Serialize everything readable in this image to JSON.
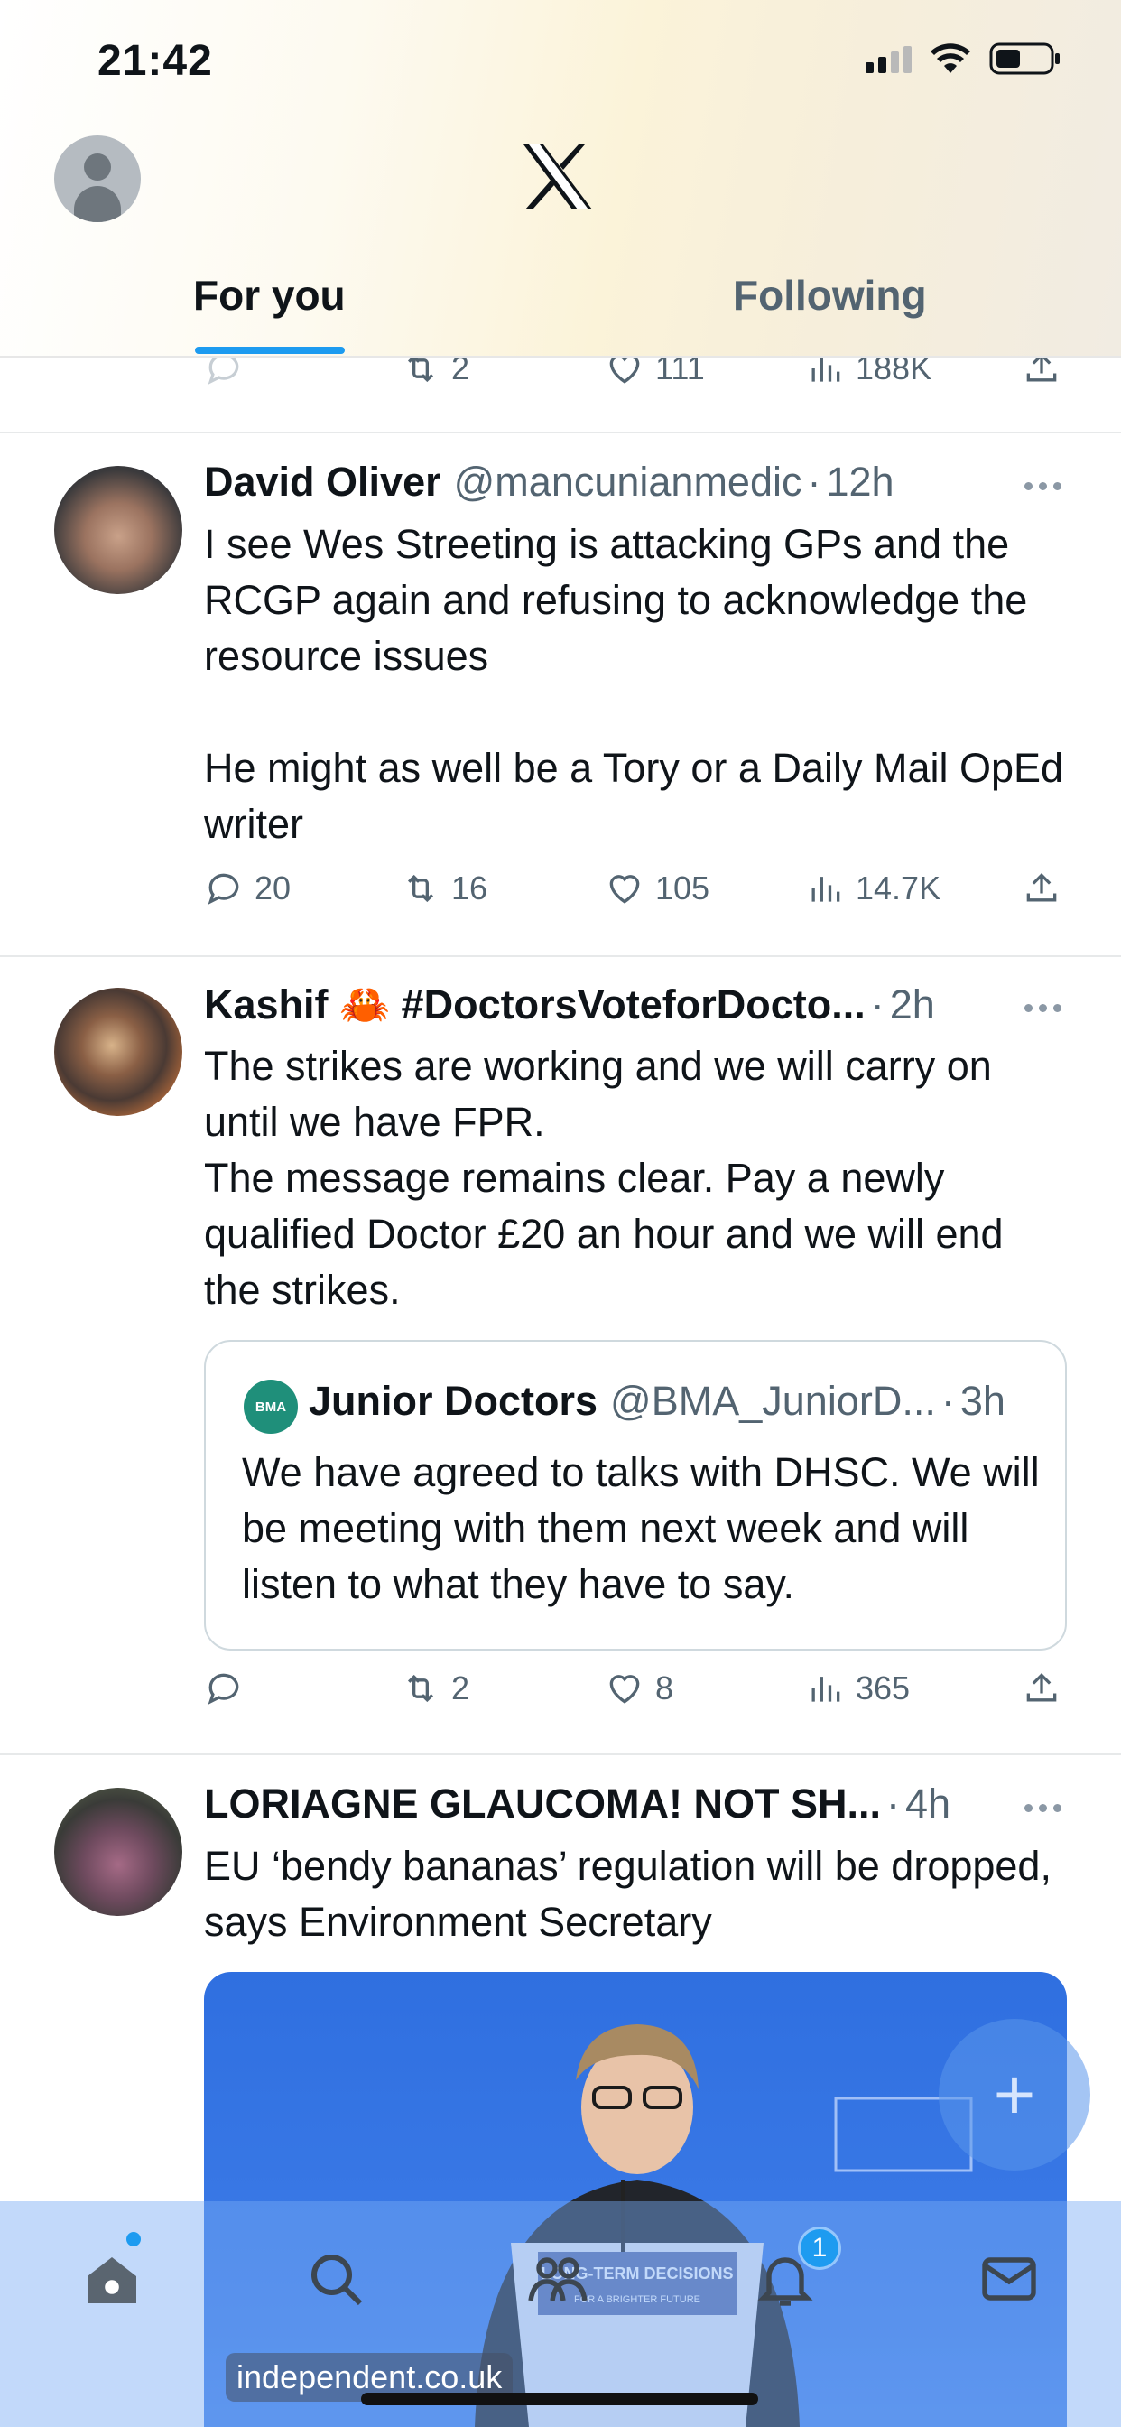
{
  "status_bar": {
    "time": "21:42"
  },
  "header": {
    "tabs": [
      {
        "label": "For you",
        "active": true
      },
      {
        "label": "Following",
        "active": false
      }
    ]
  },
  "accent_color": "#1d9bf0",
  "partial_tweet": {
    "actions": {
      "replies": "",
      "retweets": "2",
      "likes": "111",
      "views": "188K"
    }
  },
  "tweets": [
    {
      "name": "David Oliver",
      "handle": "@mancunianmedic",
      "time": "12h",
      "text": "I see Wes Streeting is attacking GPs and the RCGP again and refusing to acknowledge the resource issues\n\nHe might as well be a Tory or a Daily Mail OpEd writer",
      "actions": {
        "replies": "20",
        "retweets": "16",
        "likes": "105",
        "views": "14.7K"
      }
    },
    {
      "name": "Kashif 🦀 #DoctorsVoteforDocto...",
      "handle": "",
      "time": "2h",
      "text": "The strikes are working and we will carry on until we have FPR.\nThe message remains clear. Pay a newly qualified Doctor £20 an hour and we will end the strikes.",
      "quote": {
        "avatar_label": "BMA",
        "name": "Junior Doctors",
        "handle": "@BMA_JuniorD...",
        "time": "3h",
        "text": "We have agreed to talks with DHSC. We will be meeting with them next week and will listen to what they have to say."
      },
      "actions": {
        "replies": "",
        "retweets": "2",
        "likes": "8",
        "views": "365"
      }
    },
    {
      "name": "LORIAGNE GLAUCOMA! NOT SH...",
      "handle": "",
      "time": "4h",
      "text": "EU ‘bendy bananas’ regulation will be dropped, says Environment Secretary",
      "media": {
        "podium_text": "LONG-TERM DECISIONS",
        "podium_subtext": "FOR A BRIGHTER FUTURE",
        "source": "independent.co.uk"
      }
    }
  ],
  "fab": {
    "label": "+"
  },
  "bottom_nav": {
    "items": [
      "home-icon",
      "search-icon",
      "communities-icon",
      "bell-icon",
      "mail-icon"
    ],
    "notification_count": "1"
  }
}
